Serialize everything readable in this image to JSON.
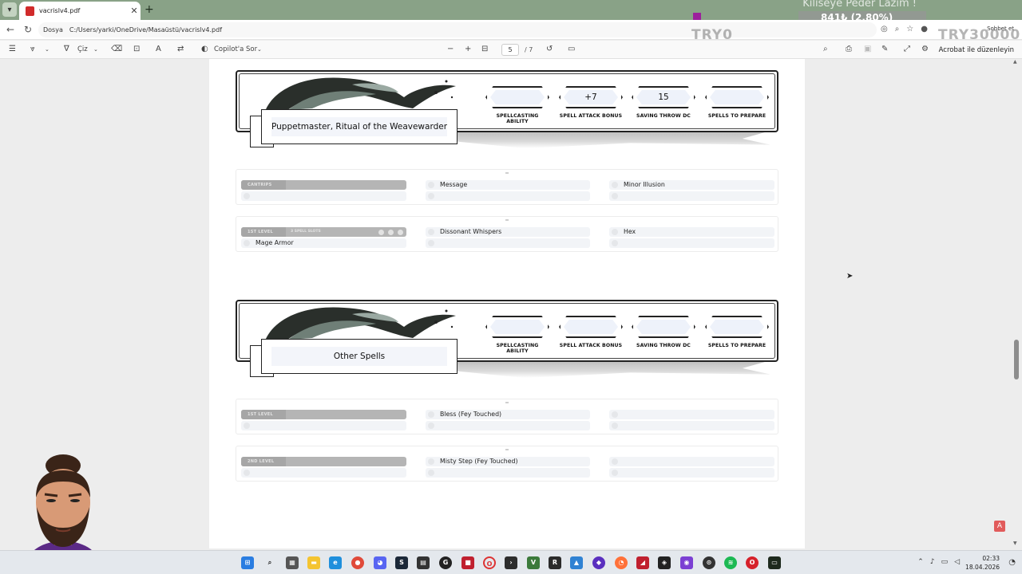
{
  "browser": {
    "tab_title": "vacrislv4.pdf",
    "tab_close": "✕",
    "new_tab": "+",
    "url_label": "Dosya",
    "url": "C:/Users/yarki/OneDrive/Masaüstü/vacrislv4.pdf",
    "chat_label": "Sohbet et"
  },
  "stream_overlay": {
    "marquee": "Kiliseye Peder Lazım !",
    "money": "841₺ (2.80%)",
    "try_left": "TRY0",
    "try_right": "TRY30000"
  },
  "pdf_toolbar": {
    "draw_label": "Çiz",
    "copilot_label": "Copilot'a Sor",
    "page_current": "5",
    "page_total": "/ 7",
    "acrobat_label": "Acrobat ile düzenleyin"
  },
  "stat_labels": [
    "SPELLCASTING ABILITY",
    "SPELL ATTACK BONUS",
    "SAVING THROW DC",
    "SPELLS TO PREPARE"
  ],
  "sections": [
    {
      "title": "Puppetmaster, Ritual of the Weavewarder",
      "stats": [
        "",
        "+7",
        "15",
        ""
      ],
      "levels": [
        {
          "label": "CANTRIPS",
          "slots_label": "",
          "col1": [],
          "col2": [
            "Message"
          ],
          "col3": [
            "Minor Illusion"
          ]
        },
        {
          "label": "1ST LEVEL",
          "slots_label": "3 SPELL SLOTS",
          "col1": [
            "Mage Armor"
          ],
          "col2": [
            "Dissonant Whispers"
          ],
          "col3": [
            "Hex"
          ]
        }
      ]
    },
    {
      "title": "Other Spells",
      "stats": [
        "",
        "",
        "",
        ""
      ],
      "levels": [
        {
          "label": "1ST LEVEL",
          "slots_label": "",
          "col1": [],
          "col2": [
            "Bless (Fey Touched)"
          ],
          "col3": []
        },
        {
          "label": "2ND LEVEL",
          "slots_label": "",
          "col1": [],
          "col2": [
            "Misty Step (Fey Touched)"
          ],
          "col3": []
        }
      ]
    }
  ],
  "taskbar": {
    "time": "02:33",
    "date": "18.04.2026"
  }
}
